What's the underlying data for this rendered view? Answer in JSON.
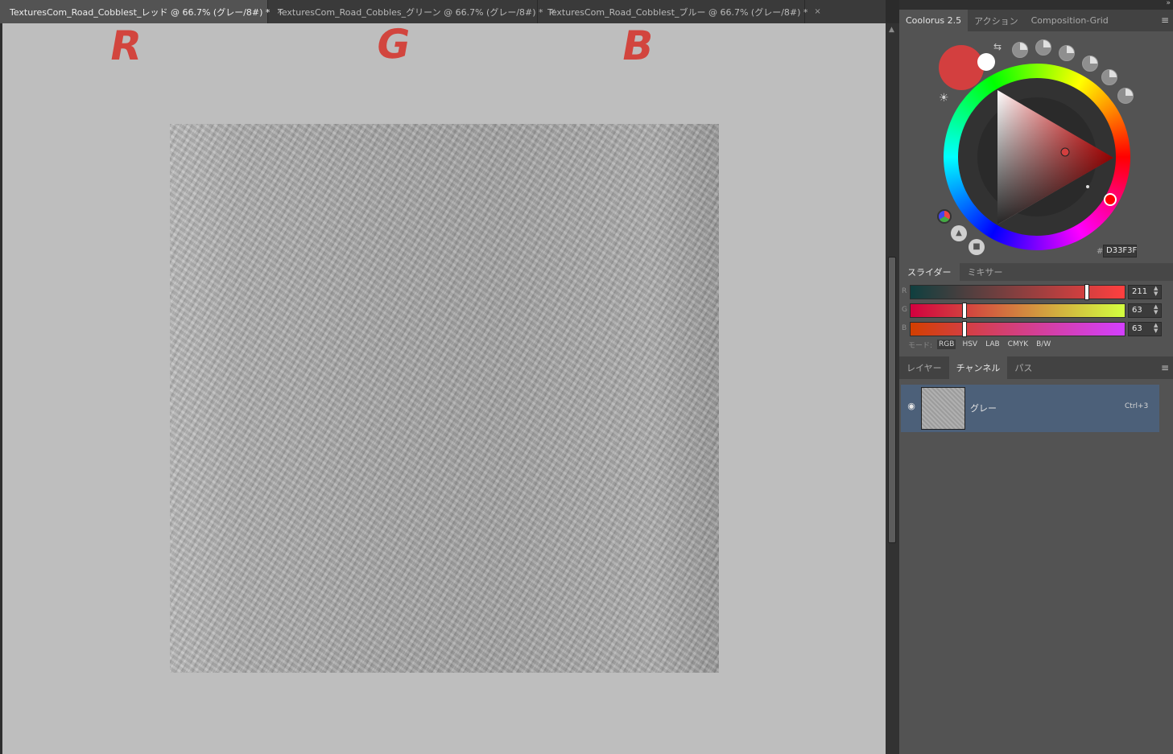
{
  "tabs": [
    {
      "title": "TexturesCom_Road_Cobblest_レッド @ 66.7% (グレー/8#) *",
      "close": "×"
    },
    {
      "title": "TexturesCom_Road_Cobbles_グリーン @ 66.7% (グレー/8#) *",
      "close": "×"
    },
    {
      "title": "TexturesCom_Road_Cobblest_ブルー @ 66.7% (グレー/8#) *",
      "close": "×"
    }
  ],
  "annotations": [
    "R",
    "G",
    "B"
  ],
  "panel": {
    "tabs": [
      "Coolorus 2.5",
      "アクション",
      "Composition-Grid"
    ],
    "color_hex_hash": "#",
    "color_hex": "D33F3F",
    "foreground_color": "#d33f3f",
    "background_color": "#ffffff"
  },
  "sliders": {
    "tabs": [
      "スライダー",
      "ミキサー"
    ],
    "rows": [
      {
        "label": "R",
        "value": "211",
        "level": 0.827
      },
      {
        "label": "G",
        "value": "63",
        "level": 0.247
      },
      {
        "label": "B",
        "value": "63",
        "level": 0.247
      }
    ],
    "mode_label": "モード:",
    "modes": [
      "RGB",
      "HSV",
      "LAB",
      "CMYK",
      "B/W"
    ]
  },
  "layers": {
    "tabs": [
      "レイヤー",
      "チャンネル",
      "パス"
    ],
    "channel": {
      "name": "グレー",
      "shortcut": "Ctrl+3"
    }
  }
}
